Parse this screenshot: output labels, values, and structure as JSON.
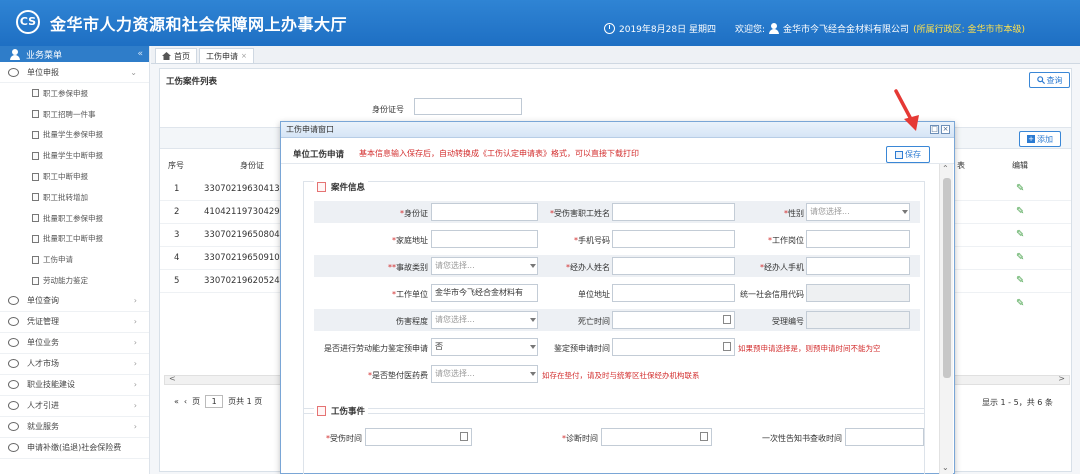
{
  "header": {
    "logo_text": "CS",
    "title": "金华市人力资源和社会保障网上办事大厅",
    "date": "2019年8月28日 星期四",
    "welcome": "欢迎您:",
    "company": "金华市今飞经合金材料有限公司",
    "region": "(所属行政区: 金华市市本级)"
  },
  "sidebar": {
    "head": "业务菜单",
    "collapse": "«",
    "top_item": {
      "label": "单位申报",
      "chev": "⌄"
    },
    "sub_items": [
      "职工参保申报",
      "职工招聘一件事",
      "批量学生参保申报",
      "批量学生中断申报",
      "职工中断申报",
      "职工批转增加",
      "批量职工参保申报",
      "批量职工中断申报",
      "工伤申请",
      "劳动能力鉴定"
    ],
    "items": [
      {
        "label": "单位查询",
        "chev": "›"
      },
      {
        "label": "凭证管理",
        "chev": "›"
      },
      {
        "label": "单位业务",
        "chev": "›"
      },
      {
        "label": "人才市场",
        "chev": "›"
      },
      {
        "label": "职业技能建设",
        "chev": "›"
      },
      {
        "label": "人才引进",
        "chev": "›"
      },
      {
        "label": "就业服务",
        "chev": "›"
      },
      {
        "label": "申请补缴(追退)社会保险费",
        "chev": ""
      }
    ]
  },
  "tabs": [
    {
      "label": "首页",
      "icon": "home-icon"
    },
    {
      "label": "工伤申请",
      "close": "×"
    }
  ],
  "panel": {
    "title": "工伤案件列表",
    "query_label": "查询",
    "id_label": "身份证号",
    "add_label": "添加",
    "columns": {
      "no": "序号",
      "id": "身份证",
      "col3": "表",
      "edit": "编辑"
    },
    "rows": [
      {
        "no": "1",
        "id": "33070219630413",
        "edit": "✎"
      },
      {
        "no": "2",
        "id": "41042119730429",
        "edit": "✎"
      },
      {
        "no": "3",
        "id": "33070219650804",
        "edit": "✎"
      },
      {
        "no": "4",
        "id": "33070219650910",
        "edit": "✎"
      },
      {
        "no": "5",
        "id": "33070219620524",
        "edit": "✎"
      },
      {
        "no": "",
        "id": "",
        "edit": "✎"
      }
    ],
    "scroll_left": "<",
    "scroll_right": ">",
    "pager": {
      "first": "«",
      "prev": "‹",
      "page_label": "页",
      "page": "1",
      "total": "页共 1 页"
    },
    "pager_info": "显示 1 - 5，共 6 条"
  },
  "modal": {
    "bar_title": "工伤申请窗口",
    "ctrl_min": "□",
    "ctrl_close": "×",
    "head_title": "单位工伤申请",
    "tip": "基本信息输入保存后，自动转换成《工伤认定申请表》格式，可以直接下载打印",
    "save_label": "保存",
    "scroll_up": "⌃",
    "scroll_down": "⌄",
    "sec1_title": "案件信息",
    "sec2_title": "工伤事件",
    "placeholder_select": "请您选择...",
    "fields": {
      "id_card": "身份证",
      "victim_name": "受伤害职工姓名",
      "gender": "性别",
      "home_addr": "家庭地址",
      "phone": "手机号码",
      "job": "工作岗位",
      "accident_type": "事故类别",
      "handler_name": "经办人姓名",
      "handler_phone": "经办人手机",
      "work_unit": "工作单位",
      "work_unit_value": "金华市今飞经合金材料有",
      "unit_addr": "单位地址",
      "credit_code": "统一社会信用代码",
      "injury_level": "伤害程度",
      "death_time": "死亡时间",
      "accept_no": "受理编号",
      "pre_apply": "是否进行劳动能力鉴定预申请",
      "pre_apply_value": "否",
      "pre_apply_time": "鉴定预申请时间",
      "pre_apply_warn": "如果预申请选择是，则预申请时间不能为空",
      "medical_adv": "是否垫付医药费",
      "medical_warn": "如存在垫付，请及时与统筹区社保经办机构联系",
      "injury_time": "受伤时间",
      "diag_time": "诊断时间",
      "notice_time": "一次性告知书查收时间"
    }
  },
  "colors": {
    "brand": "#1e6fc3",
    "accent": "#2c7bd2",
    "warning": "#d32f2f",
    "arrow": "#e53935"
  }
}
